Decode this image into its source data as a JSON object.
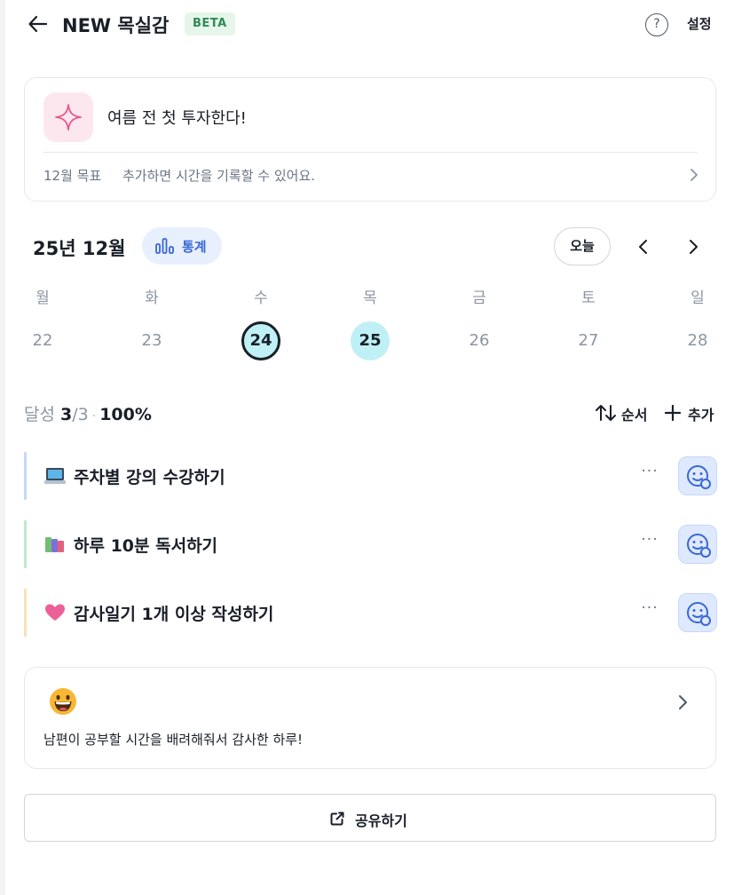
{
  "header": {
    "title": "NEW 목실감",
    "badge": "BETA",
    "help_symbol": "?",
    "settings_label": "설정"
  },
  "goal": {
    "icon": "sparkle-icon",
    "title": "여름 전 첫 투자한다!",
    "month_label": "12월 목표",
    "hint": "추가하면 시간을 기록할 수 있어요."
  },
  "calendar": {
    "month_title": "25년 12월",
    "stats_label": "통계",
    "today_label": "오늘",
    "weekdays": [
      "월",
      "화",
      "수",
      "목",
      "금",
      "토",
      "일"
    ],
    "days": [
      "22",
      "23",
      "24",
      "25",
      "26",
      "27",
      "28"
    ],
    "selected_day": "24",
    "today_day": "25"
  },
  "achievement": {
    "label": "달성",
    "done": "3",
    "total": "/3",
    "separator": "·",
    "percent": "100%"
  },
  "actions": {
    "sort_label": "순서",
    "add_label": "추가"
  },
  "habits": [
    {
      "icon": "laptop-icon",
      "label": "주차별 강의 수강하기",
      "accent": "#c9d8f8",
      "more": "···"
    },
    {
      "icon": "books-icon",
      "label": "하루 10분 독서하기",
      "accent": "#bfe9cf",
      "more": "···"
    },
    {
      "icon": "heart-icon",
      "label": "감사일기 1개 이상 작성하기",
      "accent": "#f8e1b3",
      "more": "···"
    }
  ],
  "diary": {
    "emoji": "grinning-face-icon",
    "text": "남편이 공부할 시간을 배려해줘서 감사한 하루!"
  },
  "share": {
    "label": "공유하기"
  },
  "colors": {
    "accent_blue": "#3867d6",
    "highlight": "#bff0f5",
    "beta_green": "#2e8b57"
  }
}
